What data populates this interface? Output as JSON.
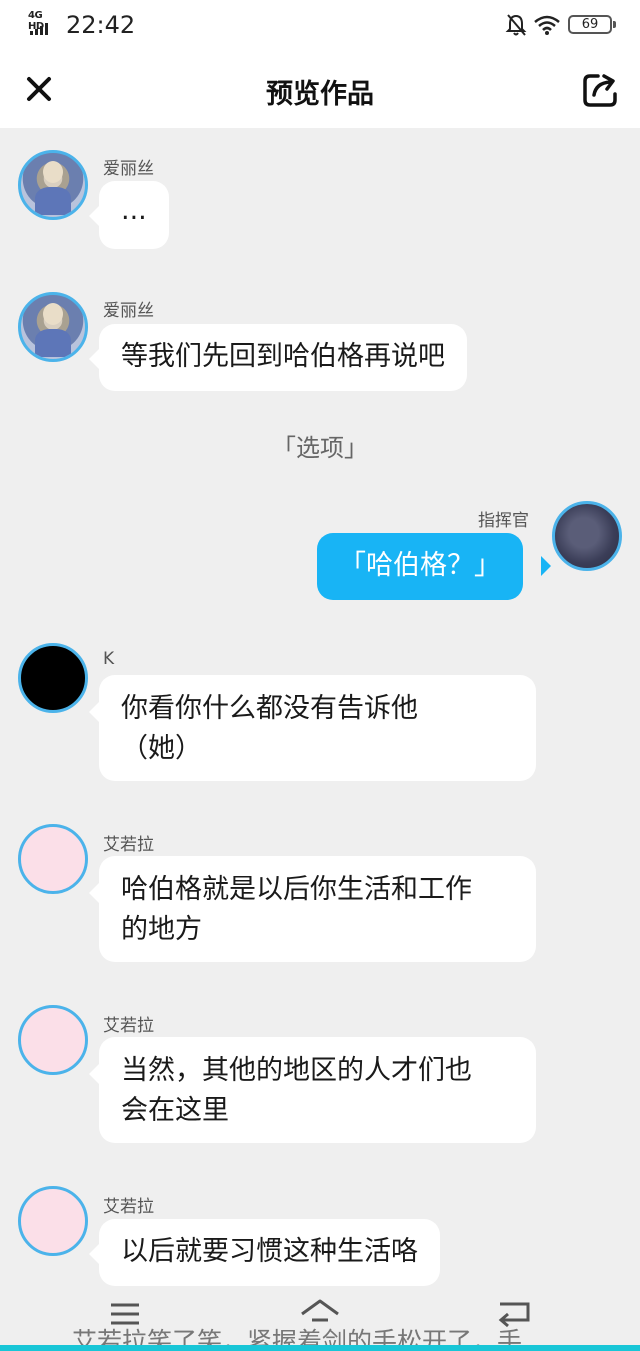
{
  "status_bar": {
    "network": "4G HD",
    "time": "22:42",
    "battery": "69"
  },
  "header": {
    "title": "预览作品"
  },
  "messages": [
    {
      "speaker": "爱丽丝",
      "text": "..."
    },
    {
      "speaker": "爱丽丝",
      "text": "等我们先回到哈伯格再说吧"
    },
    {
      "option": "「选项」"
    },
    {
      "speaker": "指挥官",
      "text": "「哈伯格？」"
    },
    {
      "speaker": "K",
      "text_line1": "你看你什么都没有告诉他",
      "text_line2": "（她）"
    },
    {
      "speaker": "艾若拉",
      "text_line1": "哈伯格就是以后你生活和工作",
      "text_line2": "的地方"
    },
    {
      "speaker": "艾若拉",
      "text_line1": "当然，其他的地区的人才们也",
      "text_line2": "会在这里"
    },
    {
      "speaker": "艾若拉",
      "text": "以后就要习惯这种生活咯"
    }
  ],
  "ticker": "艾若拉笑了笑，紧握着剑的手松开了，手",
  "colors": {
    "accent": "#18b4f5",
    "avatar_border": "#4bb3ea",
    "background": "#efefef"
  }
}
